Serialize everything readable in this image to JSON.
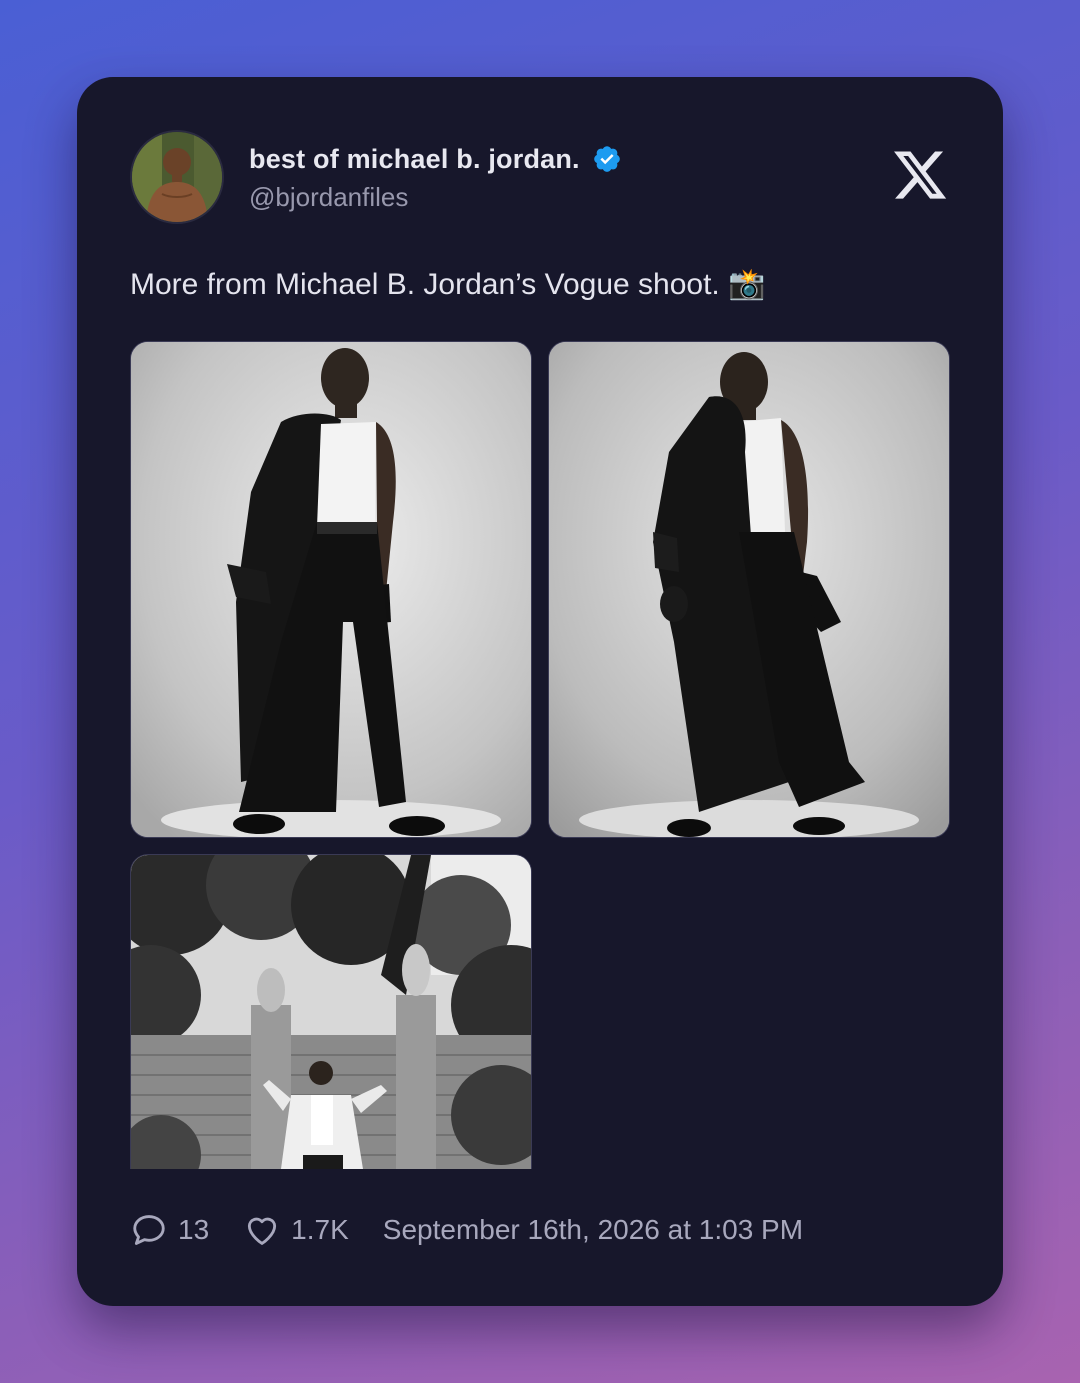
{
  "post": {
    "display_name": "best of michael b. jordan.",
    "handle": "@bjordanfiles",
    "verified": true,
    "text": "More from Michael B. Jordan’s Vogue shoot. 📸",
    "platform_icon": "x-logo-icon",
    "photos": [
      {
        "icon": "studio-photo-man-in-coat"
      },
      {
        "icon": "studio-photo-man-coat-over-shoulder"
      },
      {
        "icon": "garden-photo-man-by-brick-wall"
      }
    ]
  },
  "footer": {
    "replies_icon": "comment-icon",
    "replies": "13",
    "likes_icon": "heart-icon",
    "likes": "1.7K",
    "timestamp": "September 16th, 2026 at 1:03 PM"
  },
  "colors": {
    "card_background": "#17172b",
    "verified_badge": "#1d9bf0",
    "text_primary": "#e4e4ee",
    "text_secondary": "#9898ad"
  }
}
